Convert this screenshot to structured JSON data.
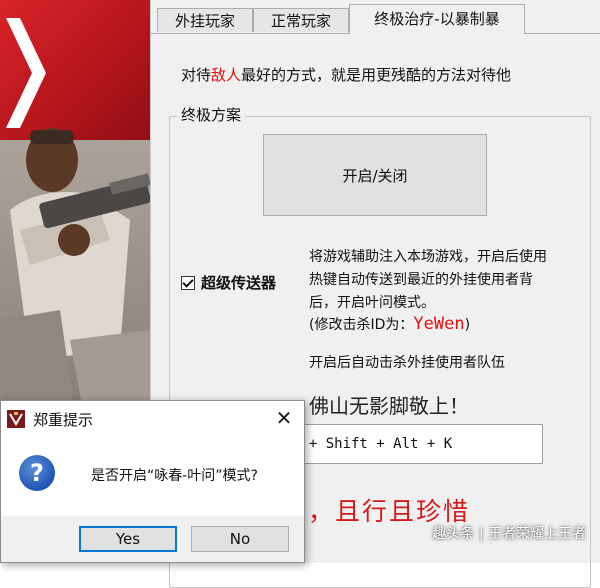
{
  "tabs": [
    {
      "label": "外挂玩家",
      "active": false
    },
    {
      "label": "正常玩家",
      "active": false
    },
    {
      "label": "终极治疗-以暴制暴",
      "active": true
    }
  ],
  "main": {
    "desc_prefix": "对待",
    "desc_highlight": "敌人",
    "desc_suffix": "最好的方式，就是用更残酷的方法对待他",
    "group_title": "终极方案",
    "toggle_button": "开启/关闭",
    "checkbox_label": "超级传送器",
    "checkbox_checked": true,
    "description": "将游戏辅助注入本场游戏，开启后使用热键自动传送到最近的外挂使用者背后，开启叶问模式。",
    "kill_id_label": "(修改击杀ID为：",
    "kill_id_value": "YeWen",
    "kill_id_close": ")",
    "auto_kill": "开启后自动击杀外挂使用者队伍",
    "foshan": "佛山无影脚敬上！",
    "hotkey": "l + Shift + Alt + K",
    "motto": "易，且行且珍惜"
  },
  "watermark": "趣头条 | 王者荣耀上王者",
  "dialog": {
    "title": "郑重提示",
    "question": "是否开启“咏春-叶问”模式?",
    "yes_label": "Yes",
    "no_label": "No",
    "close_glyph": "✕",
    "icon_glyph": "?"
  },
  "colors": {
    "accent_red": "#e01010",
    "focus_blue": "#0078d7",
    "panel_bg": "#f0f0f0"
  }
}
